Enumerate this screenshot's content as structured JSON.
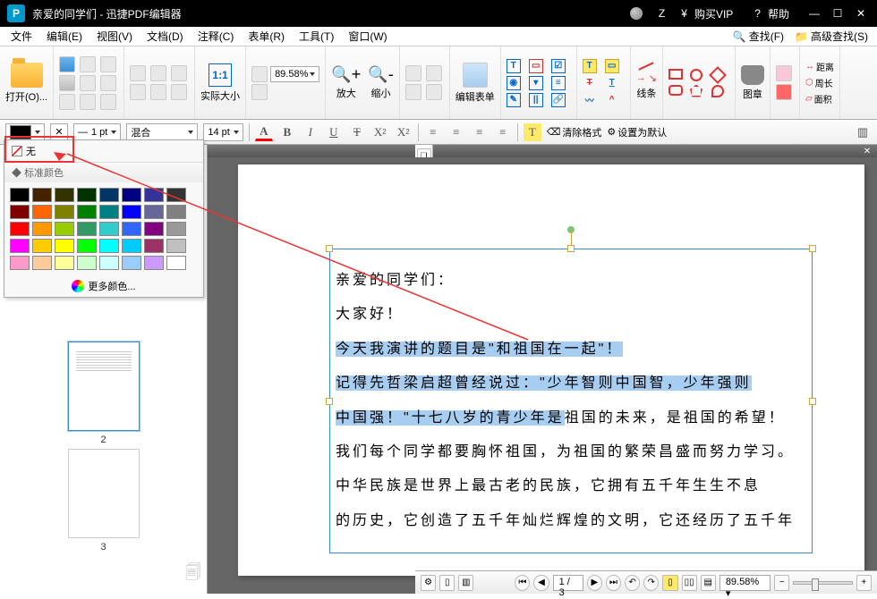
{
  "title": "亲爱的同学们 - 迅捷PDF编辑器",
  "titlebar": {
    "user": "Z",
    "vip": "购买VIP",
    "help": "帮助"
  },
  "menu": [
    "文件",
    "编辑(E)",
    "视图(V)",
    "文档(D)",
    "注释(C)",
    "表单(R)",
    "工具(T)",
    "窗口(W)"
  ],
  "menu_right": {
    "find": "查找(F)",
    "advfind": "高级查找(S)"
  },
  "toolbar": {
    "open": "打开(O)...",
    "actual": "实际大小",
    "zoom": "89.58%",
    "zoomin": "放大",
    "zoomout": "缩小",
    "editform": "编辑表单",
    "lines": "线条",
    "stamp": "图章",
    "dist": "距离",
    "perim": "周长",
    "area": "面积"
  },
  "toolbar2": {
    "line_w": "1 pt",
    "blend": "混合",
    "font_sz": "14 pt",
    "clearfmt": "清除格式",
    "setdefault": "设置为默认"
  },
  "colorpopup": {
    "none": "无",
    "header": "标准颜色",
    "more": "更多颜色...",
    "colors": [
      "#000000",
      "#442200",
      "#333300",
      "#003300",
      "#003366",
      "#000080",
      "#333399",
      "#333333",
      "#800000",
      "#ff6600",
      "#808000",
      "#008000",
      "#008080",
      "#0000ff",
      "#666699",
      "#808080",
      "#ff0000",
      "#ff9900",
      "#99cc00",
      "#339966",
      "#33cccc",
      "#3366ff",
      "#800080",
      "#999999",
      "#ff00ff",
      "#ffcc00",
      "#ffff00",
      "#00ff00",
      "#00ffff",
      "#00ccff",
      "#993366",
      "#c0c0c0",
      "#ff99cc",
      "#ffcc99",
      "#ffff99",
      "#ccffcc",
      "#ccffff",
      "#99ccff",
      "#cc99ff",
      "#ffffff"
    ]
  },
  "thumbs": {
    "p2": "2",
    "p3": "3"
  },
  "doc": {
    "l1": "亲爱的同学们：",
    "l2": "大家好！",
    "l3a": "今天我演讲的题目是\"和祖国在一起\"！",
    "l4a": "记得先哲梁启超曾经说过：\"少年智则中国智，少年强则",
    "l5a": "中国强！\"十七八岁的青少年是",
    "l5b": "祖国的未来，是祖国的希望！",
    "l6": "我们每个同学都要胸怀祖国，为祖国的繁荣昌盛而努力学习。",
    "l7": "中华民族是世界上最古老的民族，它拥有五千年生生不息",
    "l8": "的历史，它创造了五千年灿烂辉煌的文明，它还经历了五千年"
  },
  "status": {
    "page": "1 / 3",
    "zoom": "89.58%"
  }
}
